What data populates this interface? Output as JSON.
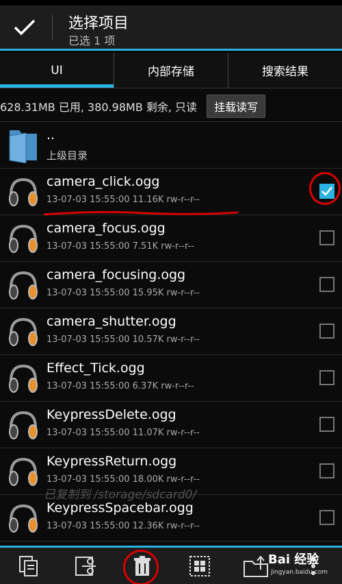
{
  "action_bar": {
    "title": "选择项目",
    "subtitle": "已选 1 项"
  },
  "tabs": [
    {
      "label": "UI",
      "active": true
    },
    {
      "label": "内部存储",
      "active": false
    },
    {
      "label": "搜索结果",
      "active": false
    }
  ],
  "storage": {
    "info": "628.31MB 已用, 380.98MB 剩余, 只读",
    "mount_button": "挂载读写"
  },
  "parent_dir": {
    "name": "..",
    "label": "上级目录"
  },
  "files": [
    {
      "name": "camera_click.ogg",
      "meta": "13-07-03 15:55:00  11.16K  rw-r--r--",
      "checked": true
    },
    {
      "name": "camera_focus.ogg",
      "meta": "13-07-03 15:55:00  7.51K  rw-r--r--",
      "checked": false
    },
    {
      "name": "camera_focusing.ogg",
      "meta": "13-07-03 15:55:00  15.95K  rw-r--r--",
      "checked": false
    },
    {
      "name": "camera_shutter.ogg",
      "meta": "13-07-03 15:55:00  10.57K  rw-r--r--",
      "checked": false
    },
    {
      "name": "Effect_Tick.ogg",
      "meta": "13-07-03 15:55:00  6.37K  rw-r--r--",
      "checked": false
    },
    {
      "name": "KeypressDelete.ogg",
      "meta": "13-07-03 15:55:00  11.07K  rw-r--r--",
      "checked": false
    },
    {
      "name": "KeypressReturn.ogg",
      "meta": "13-07-03 15:55:00  18.00K  rw-r--r--",
      "checked": false
    },
    {
      "name": "KeypressSpacebar.ogg",
      "meta": "13-07-03 15:55:00  12.36K  rw-r--r--",
      "checked": false
    }
  ],
  "toast": "已复制到 /storage/sdcard0/",
  "bottom_bar": {
    "buttons": [
      "copy-icon",
      "cut-icon",
      "delete-icon",
      "select-all-icon",
      "move-to-folder-icon",
      "more-icon"
    ]
  },
  "watermark": {
    "logo": "Bai 经验",
    "url": "jingyan.baidu.com"
  },
  "colors": {
    "accent": "#2bb3e3",
    "annotation": "#d90000"
  }
}
